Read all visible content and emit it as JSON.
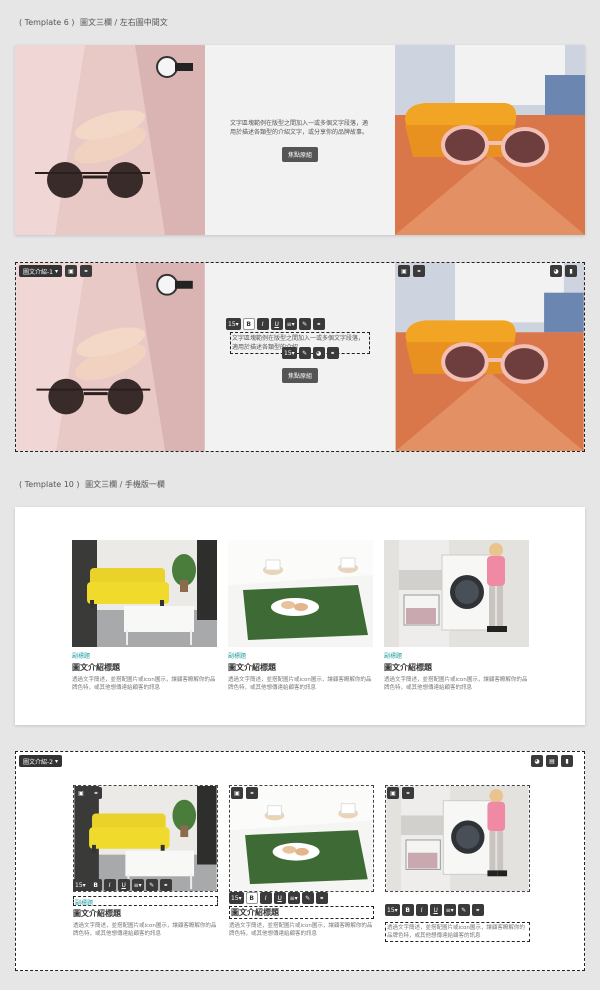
{
  "section1": {
    "tag": "( Template 6 )",
    "title": "圖文三欄 / 左右圖中間文"
  },
  "section2": {
    "tag": "( Template 10 )",
    "title": "圖文三欄 / 手機版一欄"
  },
  "t6": {
    "text": "文字區塊範例在版型之間加入一或多個文字段落，適用於描述各類型的介紹文字，或分享你的品牌故事。",
    "button": "焦點原組"
  },
  "t6edit": {
    "tag_label": "圖文介紹-1",
    "font_size": "15",
    "text": "文字區塊範例在版型之間加入一或多個文字段落，適用於描述各類型的介紹",
    "button": "焦點原組"
  },
  "t10": {
    "cards": [
      {
        "category": "副標題",
        "title": "圖文介紹標題",
        "desc": "透過文字簡述，並搭配圖片或icon圖示，讓顧客瞭解你的品牌色特，或其他想傳達給顧客的訊息"
      },
      {
        "category": "副標題",
        "title": "圖文介紹標題",
        "desc": "透過文字簡述，並搭配圖片或icon圖示，讓顧客瞭解你的品牌色特，或其他想傳達給顧客的訊息"
      },
      {
        "category": "副標題",
        "title": "圖文介紹標題",
        "desc": "透過文字簡述，並搭配圖片或icon圖示，讓顧客瞭解你的品牌色特，或其他想傳達給顧客的訊息"
      }
    ]
  },
  "t10edit": {
    "tag_label": "圖文介紹-2",
    "font_size": "15",
    "cards": [
      {
        "category": "副標題",
        "title": "圖文介紹標題",
        "desc": "透過文字簡述，並搭配圖片或icon圖示，讓顧客瞭解你的品牌色特，或其他想傳達給顧客的訊息"
      },
      {
        "category": "",
        "title": "圖文介紹標題",
        "desc": "透過文字簡述，並搭配圖片或icon圖示，讓顧客瞭解你的品牌色特，或其他想傳達給顧客的訊息"
      },
      {
        "category": "",
        "title": "",
        "desc": "透過文字簡述，並搭配圖片或icon圖示，讓顧客瞭解你的品牌色特，或其他想傳達給顧客的訊息"
      }
    ]
  },
  "toolbar": {
    "bold": "B",
    "italic": "I",
    "underline": "U"
  },
  "colors": {
    "accent": "#2aa1a1",
    "toolbar": "#3a3a3a",
    "page_bg": "#e6e6e6"
  }
}
